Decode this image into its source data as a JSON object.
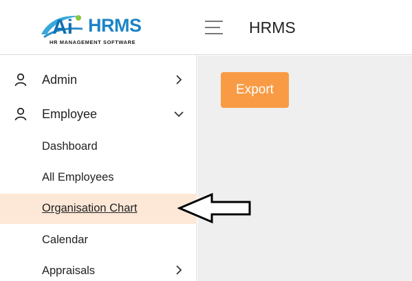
{
  "header": {
    "logo_main": "HRMS",
    "logo_sub": "HR MANAGEMENT SOFTWARE",
    "title": "HRMS"
  },
  "sidebar": {
    "items": [
      {
        "label": "Admin",
        "icon": "user-icon",
        "chevron": "chevron-right-icon"
      },
      {
        "label": "Employee",
        "icon": "user-icon",
        "chevron": "chevron-down-icon",
        "children": [
          {
            "label": "Dashboard"
          },
          {
            "label": "All Employees"
          },
          {
            "label": "Organisation Chart",
            "active": true
          },
          {
            "label": "Calendar"
          },
          {
            "label": "Appraisals",
            "chevron": "chevron-right-icon"
          }
        ]
      }
    ]
  },
  "main": {
    "export_label": "Export"
  },
  "colors": {
    "accent": "#f99b44",
    "active_bg": "#fde8d7",
    "logo_blue": "#1c84c6",
    "content_bg": "#efefef"
  }
}
